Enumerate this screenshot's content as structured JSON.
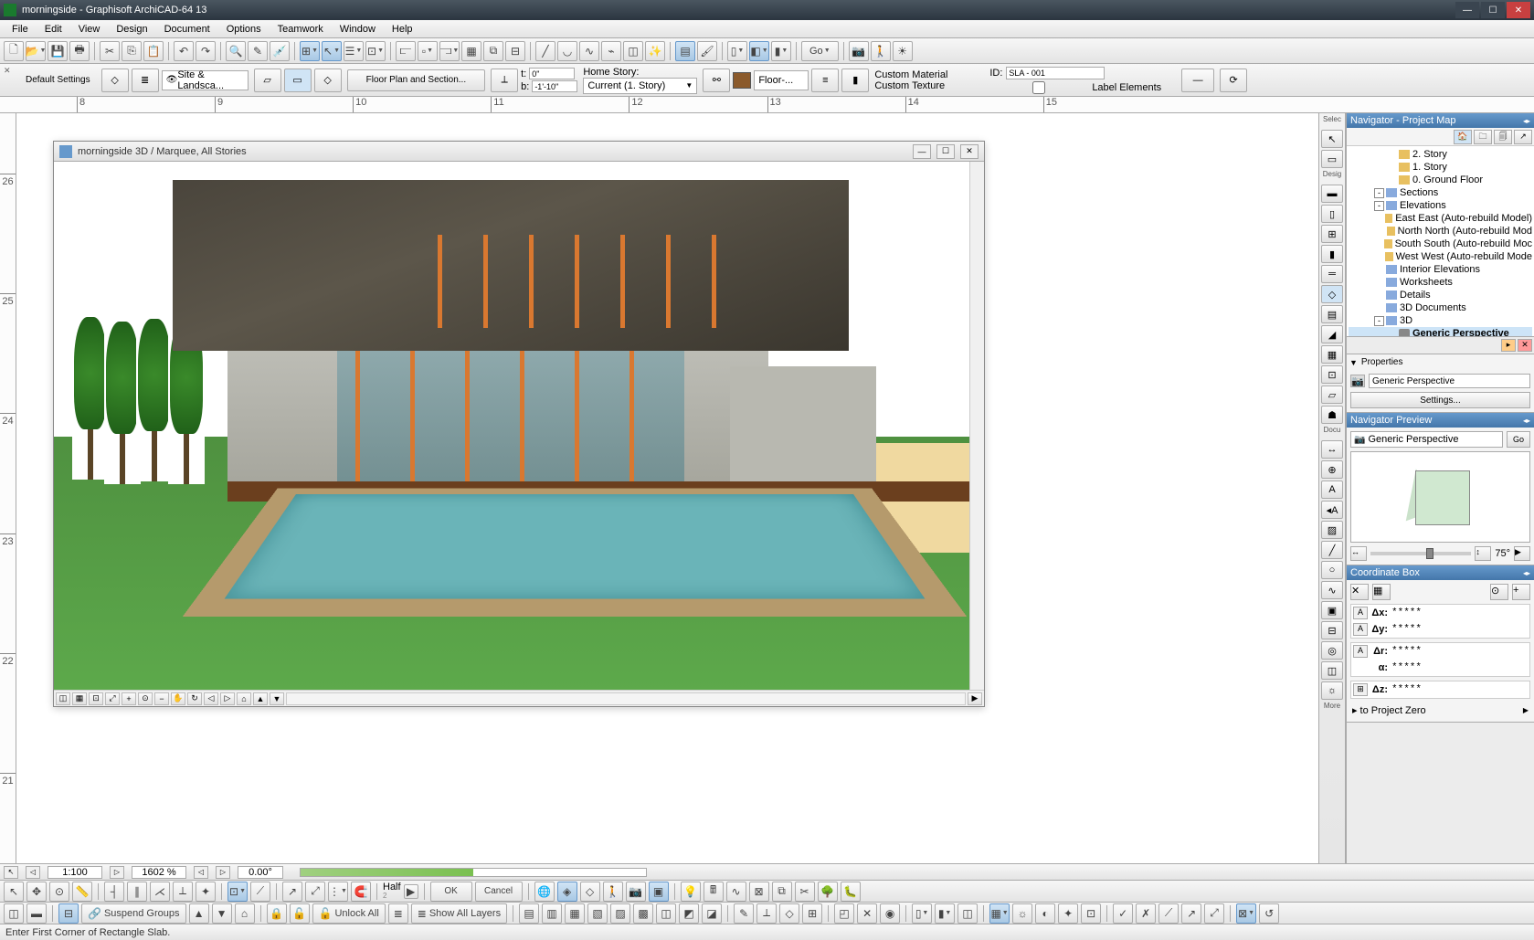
{
  "app": {
    "title": "morningside - Graphisoft ArchiCAD-64 13"
  },
  "menu": [
    "File",
    "Edit",
    "View",
    "Design",
    "Document",
    "Options",
    "Teamwork",
    "Window",
    "Help"
  ],
  "infobar": {
    "default_settings": "Default Settings",
    "layer_combo": "Site & Landsca...",
    "floorplan_btn": "Floor Plan and Section...",
    "dim_top_val": "0\"",
    "dim_bot_label": "b:",
    "dim_bot_val": "-1'-10\"",
    "home_story_label": "Home Story:",
    "home_story_val": "Current (1. Story)",
    "floor_label": "Floor-...",
    "custom_mat": "Custom Material",
    "custom_tex": "Custom Texture",
    "id_label": "ID:",
    "id_val": "SLA - 001",
    "label_elements": "Label Elements"
  },
  "toolbar1": {
    "go": "Go"
  },
  "window3d": {
    "title": "morningside 3D / Marquee, All Stories"
  },
  "toolbox": {
    "select_label": "Selec",
    "design_label": "Desig",
    "document_label": "Docu",
    "more_label": "More"
  },
  "navigator": {
    "title": "Navigator - Project Map",
    "items": [
      {
        "indent": 3,
        "icon": "st",
        "label": "2. Story"
      },
      {
        "indent": 3,
        "icon": "st",
        "label": "1. Story"
      },
      {
        "indent": 3,
        "icon": "st",
        "label": "0. Ground Floor"
      },
      {
        "indent": 2,
        "exp": "-",
        "icon": "grp",
        "label": "Sections"
      },
      {
        "indent": 2,
        "exp": "-",
        "icon": "grp",
        "label": "Elevations"
      },
      {
        "indent": 3,
        "icon": "st",
        "label": "East East (Auto-rebuild Model)"
      },
      {
        "indent": 3,
        "icon": "st",
        "label": "North North (Auto-rebuild Mod"
      },
      {
        "indent": 3,
        "icon": "st",
        "label": "South South (Auto-rebuild Moc"
      },
      {
        "indent": 3,
        "icon": "st",
        "label": "West West (Auto-rebuild Mode"
      },
      {
        "indent": 2,
        "icon": "grp",
        "label": "Interior Elevations"
      },
      {
        "indent": 2,
        "icon": "grp",
        "label": "Worksheets"
      },
      {
        "indent": 2,
        "icon": "grp",
        "label": "Details"
      },
      {
        "indent": 2,
        "icon": "grp",
        "label": "3D Documents"
      },
      {
        "indent": 2,
        "exp": "-",
        "icon": "grp",
        "label": "3D"
      },
      {
        "indent": 3,
        "icon": "cam",
        "label": "Generic Perspective",
        "sel": true
      }
    ]
  },
  "properties": {
    "title": "Properties",
    "value": "Generic Perspective",
    "settings_btn": "Settings..."
  },
  "preview": {
    "title": "Navigator Preview",
    "combo": "Generic Perspective",
    "go": "Go",
    "angle": "75°"
  },
  "coord": {
    "title": "Coordinate Box",
    "dx_label": "Δx:",
    "dy_label": "Δy:",
    "dr_label": "Δr:",
    "da_label": "α:",
    "dz_label": "Δz:",
    "star_val": "*****",
    "ref": "to Project Zero"
  },
  "bottom1": {
    "scale": "1:100",
    "zoom": "1602 %",
    "angle": "0.00°"
  },
  "bottom2": {
    "half_label": "Half",
    "half_sub": "2",
    "ok": "OK",
    "cancel": "Cancel"
  },
  "bottom3": {
    "suspend_groups": "Suspend Groups",
    "unlock_all": "Unlock All",
    "show_all_layers": "Show All Layers"
  },
  "status": "Enter First Corner of Rectangle Slab."
}
